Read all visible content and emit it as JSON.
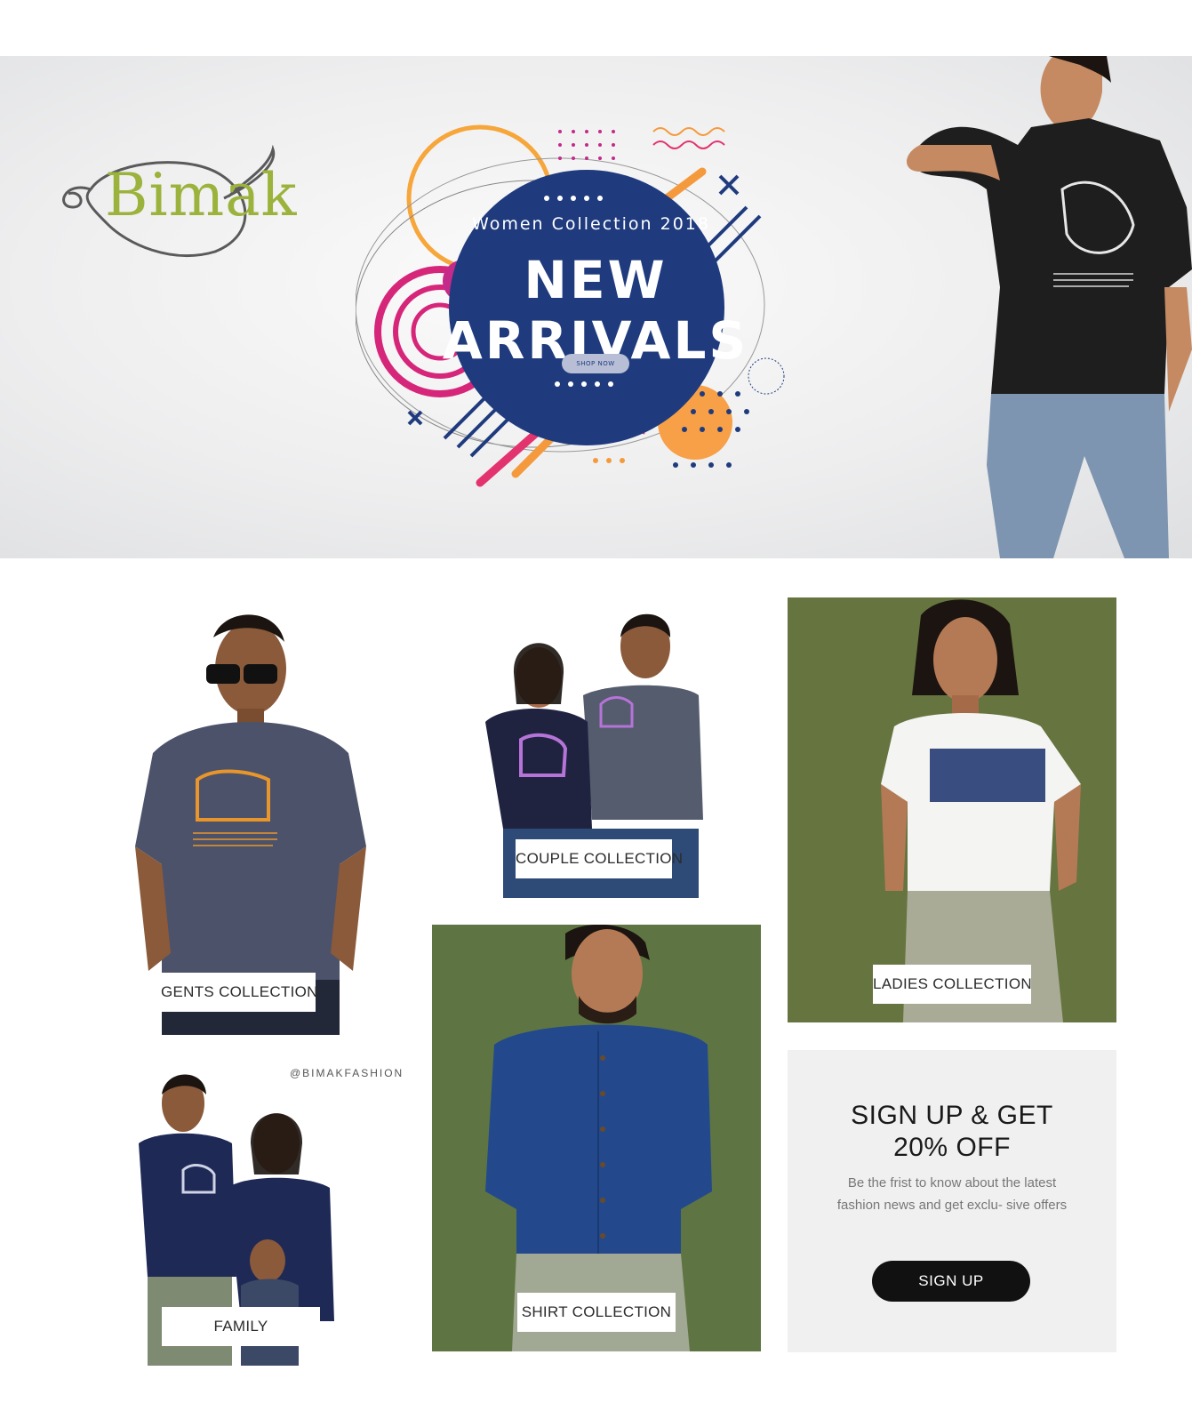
{
  "hero": {
    "logo": "Bimak",
    "subtitle": "Women Collection 2018",
    "title": "NEW ARRIVALS",
    "shop_label": "SHOP NOW"
  },
  "collections": {
    "gents": "GENTS COLLECTION",
    "couple": "COUPLE COLLECTION",
    "ladies": "LADIES COLLECTION",
    "shirt": "SHIRT COLLECTION",
    "family": "FAMILY",
    "family_tag": "@BIMAKFASHION"
  },
  "signup": {
    "title_line1": "SIGN UP & GET",
    "title_line2": "20% OFF",
    "text": "Be the frist to know about the latest fashion news and get exclu- sive offers",
    "button": "SIGN UP"
  },
  "colors": {
    "brand_green": "#9bb33c",
    "hero_navy": "#1f3b7e",
    "olive_bg": "#66743f",
    "signup_bg": "#f0f0f0",
    "button_bg": "#111111"
  }
}
